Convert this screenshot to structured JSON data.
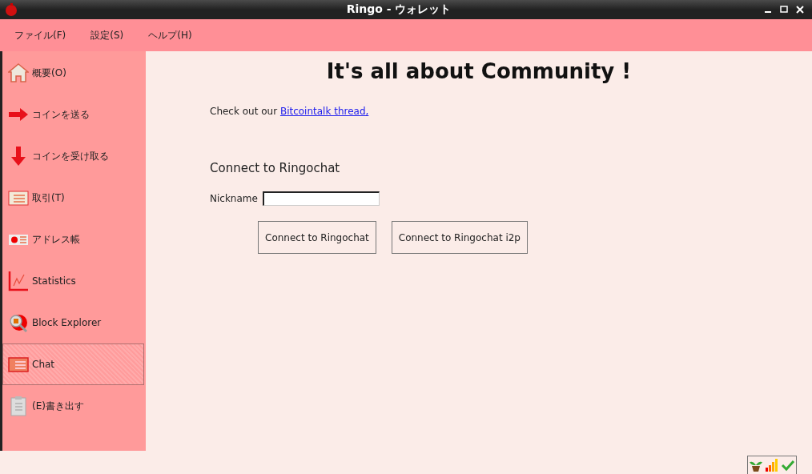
{
  "window": {
    "title": "Ringo - ウォレット"
  },
  "menu": [
    {
      "label": "ファイル(F)"
    },
    {
      "label": "設定(S)"
    },
    {
      "label": "ヘルプ(H)"
    }
  ],
  "sidebar": {
    "items": [
      {
        "kind": "home",
        "label": "概要(O)",
        "selected": false
      },
      {
        "kind": "send",
        "label": "コインを送る",
        "selected": false
      },
      {
        "kind": "receive",
        "label": "コインを受け取る",
        "selected": false
      },
      {
        "kind": "list",
        "label": "取引(T)",
        "selected": false
      },
      {
        "kind": "card",
        "label": "アドレス帳",
        "selected": false
      },
      {
        "kind": "chart",
        "label": "Statistics",
        "selected": false
      },
      {
        "kind": "explorer",
        "label": "Block Explorer",
        "selected": false
      },
      {
        "kind": "chat",
        "label": "Chat",
        "selected": true
      },
      {
        "kind": "clipboard",
        "label": "(E)書き出す",
        "selected": false
      }
    ]
  },
  "content": {
    "heading": "It's all about Community !",
    "intro": "Check out our",
    "link": "Bitcointalk thread,",
    "section_title": "Connect to Ringochat",
    "nickname_label": "Nickname",
    "buttons": [
      "Connect to Ringochat",
      "Connect to Ringochat i2p"
    ]
  }
}
